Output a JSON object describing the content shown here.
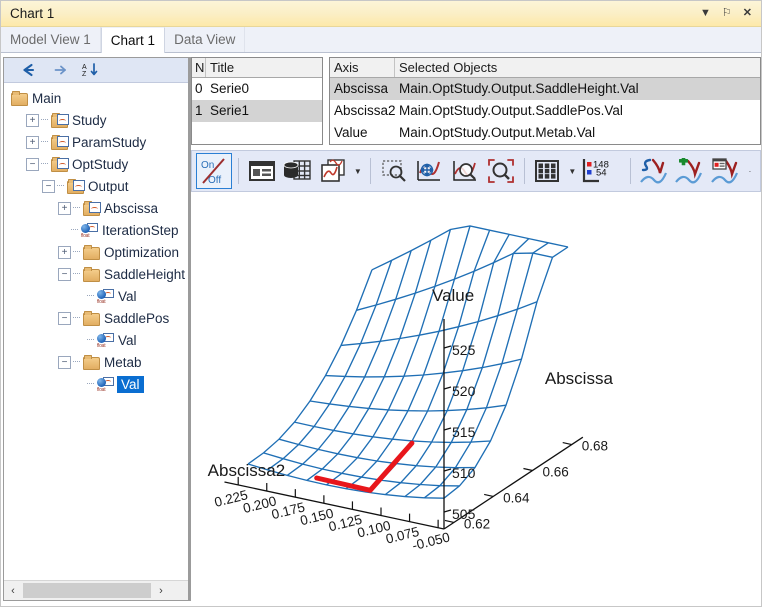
{
  "window": {
    "title": "Chart 1",
    "buttons": [
      {
        "name": "dropdown",
        "glyph": "▼"
      },
      {
        "name": "pin",
        "glyph": "⚐"
      },
      {
        "name": "close",
        "glyph": "✕"
      }
    ]
  },
  "tabs": [
    {
      "label": "Model View 1",
      "active": false
    },
    {
      "label": "Chart 1",
      "active": true
    },
    {
      "label": "Data View",
      "active": false
    }
  ],
  "tree": {
    "toolbar": [
      {
        "name": "back-arrow",
        "glyph": "←"
      },
      {
        "name": "forward-arrow",
        "glyph": "→"
      },
      {
        "name": "sort-az",
        "glyph": "AZ↓"
      }
    ],
    "nodes": [
      {
        "label": "Main",
        "depth": 0,
        "icon": "folder",
        "expander": "",
        "selected": false
      },
      {
        "label": "Study",
        "depth": 1,
        "icon": "folder-chart",
        "expander": "+",
        "selected": false
      },
      {
        "label": "ParamStudy",
        "depth": 1,
        "icon": "folder-chart",
        "expander": "+",
        "selected": false
      },
      {
        "label": "OptStudy",
        "depth": 1,
        "icon": "folder-chart",
        "expander": "−",
        "selected": false
      },
      {
        "label": "Output",
        "depth": 2,
        "icon": "folder-chart",
        "expander": "−",
        "selected": false
      },
      {
        "label": "Abscissa",
        "depth": 3,
        "icon": "folder-chart",
        "expander": "+",
        "selected": false
      },
      {
        "label": "IterationStep",
        "depth": 3,
        "icon": "float",
        "expander": "",
        "selected": false
      },
      {
        "label": "Optimization",
        "depth": 3,
        "icon": "folder",
        "expander": "+",
        "selected": false
      },
      {
        "label": "SaddleHeight",
        "depth": 3,
        "icon": "folder",
        "expander": "−",
        "selected": false
      },
      {
        "label": "Val",
        "depth": 4,
        "icon": "float",
        "expander": "",
        "selected": false
      },
      {
        "label": "SaddlePos",
        "depth": 3,
        "icon": "folder",
        "expander": "−",
        "selected": false
      },
      {
        "label": "Val",
        "depth": 4,
        "icon": "float",
        "expander": "",
        "selected": false
      },
      {
        "label": "Metab",
        "depth": 3,
        "icon": "folder",
        "expander": "−",
        "selected": false
      },
      {
        "label": "Val",
        "depth": 4,
        "icon": "float",
        "expander": "",
        "selected": true
      }
    ],
    "scrollbar": {
      "left_glyph": "‹",
      "right_glyph": "›"
    }
  },
  "series_grid": {
    "headers": [
      "N",
      "Title"
    ],
    "rows": [
      {
        "n": "0",
        "title": "Serie0",
        "highlighted": false
      },
      {
        "n": "1",
        "title": "Serie1",
        "highlighted": true
      }
    ]
  },
  "axis_grid": {
    "headers": [
      "Axis",
      "Selected Objects"
    ],
    "rows": [
      {
        "axis": "Abscissa",
        "object": "Main.OptStudy.Output.SaddleHeight.Val",
        "highlighted": true
      },
      {
        "axis": "Abscissa2",
        "object": "Main.OptStudy.Output.SaddlePos.Val",
        "highlighted": false
      },
      {
        "axis": "Value",
        "object": "Main.OptStudy.Output.Metab.Val",
        "highlighted": false
      }
    ]
  },
  "toolbar": {
    "on_off": {
      "on_label": "On",
      "off_label": "Off"
    },
    "legend_counts": {
      "red": "148",
      "blue": "54"
    },
    "buttons": [
      {
        "name": "on-off-toggle"
      },
      {
        "name": "chart-properties"
      },
      {
        "name": "data-source"
      },
      {
        "name": "copy-chart"
      },
      {
        "name": "copy-chart-dropdown"
      },
      {
        "name": "zoom-select"
      },
      {
        "name": "pan-chart"
      },
      {
        "name": "zoom-window"
      },
      {
        "name": "zoom-fit"
      },
      {
        "name": "grid-toggle"
      },
      {
        "name": "grid-dropdown"
      },
      {
        "name": "legend-counts"
      },
      {
        "name": "edit-curve"
      },
      {
        "name": "add-curve"
      },
      {
        "name": "curve-properties"
      }
    ]
  },
  "chart_data": {
    "type": "line",
    "title": "",
    "xlabel": "Abscissa2",
    "ylabel": "Abscissa",
    "zlabel": "Value",
    "axes": {
      "abscissa2": {
        "label": "Abscissa2",
        "ticks": [
          "-0.050",
          "0.075",
          "0.100",
          "0.125",
          "0.150",
          "0.175",
          "0.200",
          "0.225"
        ],
        "range": [
          -0.05,
          0.225
        ]
      },
      "abscissa": {
        "label": "Abscissa",
        "ticks": [
          "0.62",
          "0.64",
          "0.66",
          "0.68"
        ],
        "range": [
          0.62,
          0.69
        ]
      },
      "value": {
        "label": "Value",
        "ticks": [
          "505",
          "510",
          "515",
          "520",
          "525"
        ],
        "range": [
          503,
          528
        ]
      }
    },
    "series": [
      {
        "name": "Serie0",
        "style": "surface-mesh",
        "color": "#1f6fb5",
        "description": "3D wireframe surface of Value over Abscissa2 x Abscissa"
      },
      {
        "name": "Serie1",
        "style": "polyline",
        "color": "#e8161b",
        "description": "Red optimization path on the surface",
        "points": [
          {
            "abscissa2": 0.055,
            "abscissa": 0.627,
            "value": 506.5
          },
          {
            "abscissa2": 0.118,
            "abscissa": 0.631,
            "value": 506.2
          },
          {
            "abscissa2": 0.134,
            "abscissa": 0.662,
            "value": 511.8
          }
        ]
      }
    ],
    "grid": true,
    "legend": false
  }
}
